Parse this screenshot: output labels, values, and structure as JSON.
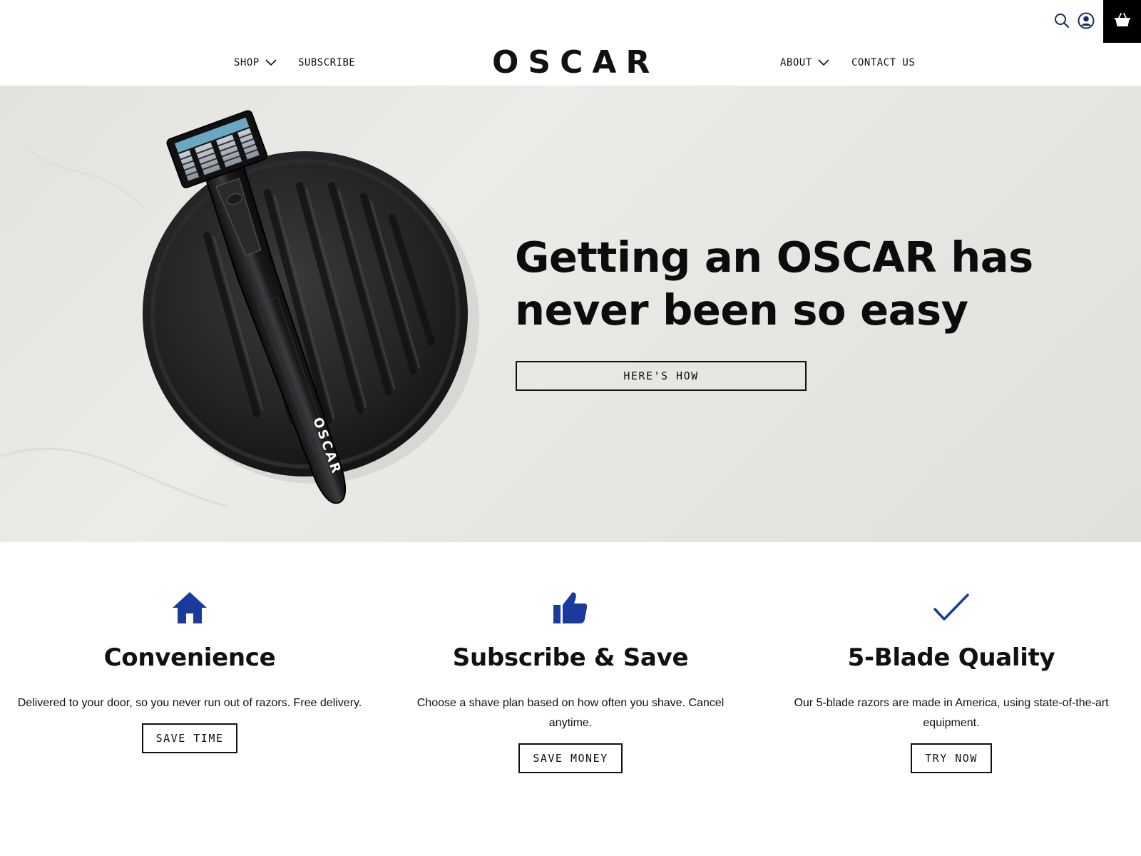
{
  "header": {
    "logo_text": "OSCAR",
    "nav_left": [
      {
        "label": "SHOP"
      },
      {
        "label": "SUBSCRIBE"
      }
    ],
    "nav_right": [
      {
        "label": "ABOUT"
      },
      {
        "label": "CONTACT US"
      }
    ],
    "icons": [
      "search-icon",
      "account-icon",
      "cart-icon"
    ]
  },
  "hero": {
    "headline": "Getting an OSCAR has never been so easy",
    "cta_label": "HERE'S HOW",
    "razor_handle_text": "OSCAR"
  },
  "features": [
    {
      "icon": "home-icon",
      "title": "Convenience",
      "description": "Delivered to your door, so you never run out of razors. Free delivery.",
      "button_label": "SAVE TIME"
    },
    {
      "icon": "thumbs-up-icon",
      "title": "Subscribe & Save",
      "description": "Choose a shave plan based on how often you shave. Cancel anytime.",
      "button_label": "SAVE MONEY"
    },
    {
      "icon": "checkmark-icon",
      "title": "5-Blade Quality",
      "description": "Our 5-blade razors are made in America, using state-of-the-art equipment.",
      "button_label": "TRY NOW"
    }
  ],
  "colors": {
    "accent_blue": "#1a3a9c",
    "text": "#111111",
    "hero_background": "#e6e4e0",
    "cart_background": "#000000"
  }
}
